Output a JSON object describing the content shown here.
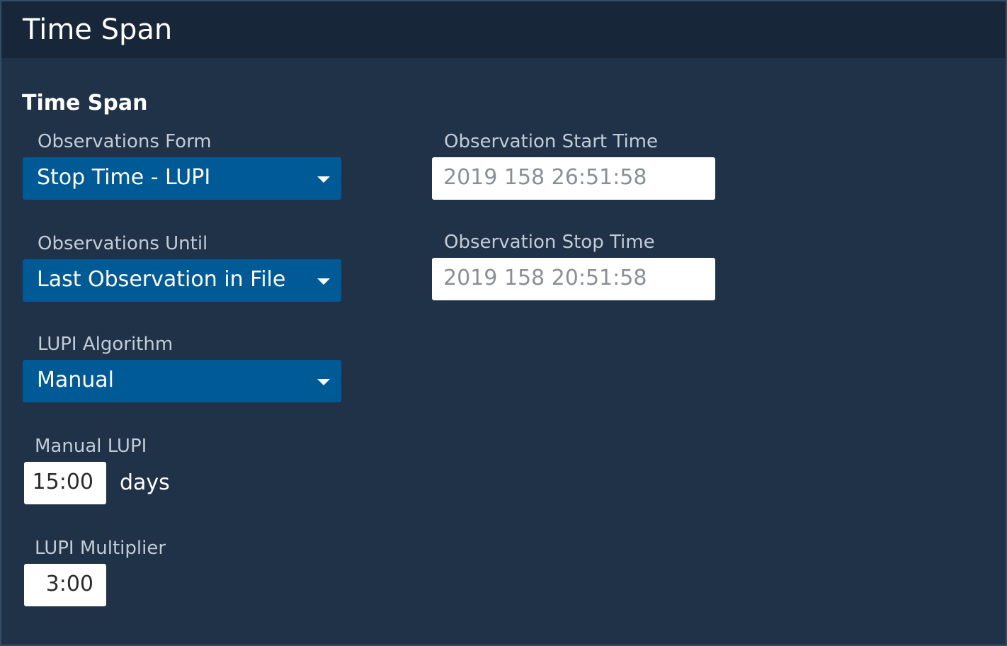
{
  "header": {
    "title": "Time Span"
  },
  "section": {
    "title": "Time Span"
  },
  "observations_form": {
    "label": "Observations Form",
    "value": "Stop Time - LUPI"
  },
  "observations_until": {
    "label": "Observations Until",
    "value": "Last Observation in File"
  },
  "lupi_algorithm": {
    "label": "LUPI Algorithm",
    "value": "Manual"
  },
  "manual_lupi": {
    "label": "Manual LUPI",
    "value": "15:00",
    "unit": "days"
  },
  "lupi_multiplier": {
    "label": "LUPI Multiplier",
    "value": "3:00"
  },
  "start_time": {
    "label": "Observation Start Time",
    "value": "2019 158 26:51:58"
  },
  "stop_time": {
    "label": "Observation Stop Time",
    "value": "2019 158 20:51:58"
  },
  "icons": {
    "dropdown": "chevron-down-icon"
  },
  "colors": {
    "header_bg": "#172638",
    "panel_bg": "#1f3247",
    "select_bg": "#005a96",
    "label": "#c2ccd6"
  }
}
